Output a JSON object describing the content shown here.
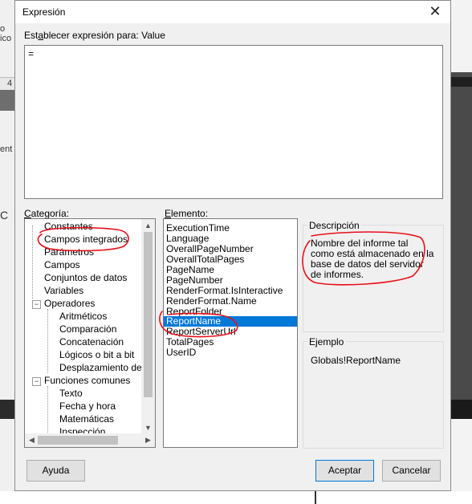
{
  "background": {
    "left_fragments": [
      "o",
      "ico",
      "ent",
      "C"
    ],
    "tab_number": "4"
  },
  "dialog": {
    "title": "Expresión",
    "close_glyph": "✕",
    "expression_label_prefix": "Est",
    "expression_label_accel": "a",
    "expression_label_rest": "blecer expresión para: Value",
    "expression_value": "=",
    "category_label_accel": "C",
    "category_label_rest": "ategoría:",
    "element_label_accel": "E",
    "element_label_rest": "lemento:",
    "description_title": "Descripción",
    "description_text": "Nombre del informe tal como está almacenado en la base de datos del servidor de informes.",
    "example_title": "Ejemplo",
    "example_text": "Globals!ReportName",
    "help_button": "Ayuda",
    "ok_button": "Aceptar",
    "cancel_button": "Cancelar"
  },
  "categories": [
    {
      "label": "Constantes",
      "toggle": ""
    },
    {
      "label": "Campos integrados",
      "toggle": ""
    },
    {
      "label": "Parámetros",
      "toggle": ""
    },
    {
      "label": "Campos",
      "toggle": ""
    },
    {
      "label": "Conjuntos de datos",
      "toggle": ""
    },
    {
      "label": "Variables",
      "toggle": ""
    },
    {
      "label": "Operadores",
      "toggle": "−"
    },
    {
      "label": "Aritméticos",
      "toggle": ""
    },
    {
      "label": "Comparación",
      "toggle": ""
    },
    {
      "label": "Concatenación",
      "toggle": ""
    },
    {
      "label": "Lógicos o bit a bit",
      "toggle": ""
    },
    {
      "label": "Desplazamiento de b",
      "toggle": ""
    },
    {
      "label": "Funciones comunes",
      "toggle": "−"
    },
    {
      "label": "Texto",
      "toggle": ""
    },
    {
      "label": "Fecha y hora",
      "toggle": ""
    },
    {
      "label": "Matemáticas",
      "toggle": ""
    },
    {
      "label": "Inspección",
      "toggle": ""
    }
  ],
  "elements": [
    "ExecutionTime",
    "Language",
    "OverallPageNumber",
    "OverallTotalPages",
    "PageName",
    "PageNumber",
    "RenderFormat.IsInteractive",
    "RenderFormat.Name",
    "ReportFolder",
    "ReportName",
    "ReportServerUrl",
    "TotalPages",
    "UserID"
  ],
  "selected_element": "ReportName",
  "colors": {
    "selection": "#0078d7",
    "annotation": "#e8101a"
  }
}
